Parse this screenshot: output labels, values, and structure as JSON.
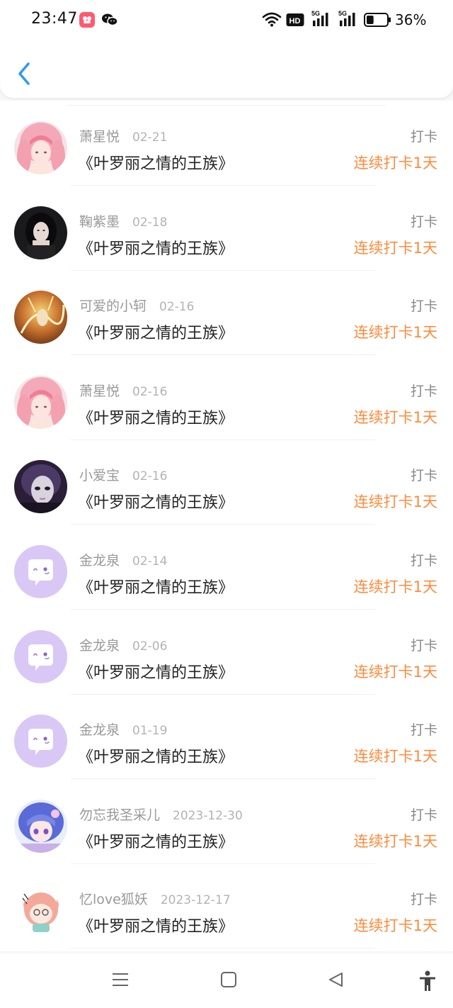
{
  "status_bar": {
    "time": "23:47",
    "battery_percent_text": "36%",
    "battery_level": 0.36,
    "network_badges": [
      "HD",
      "5G",
      "5G"
    ],
    "icons": [
      "app-notification-icon",
      "wechat-icon",
      "wifi-icon",
      "hd-icon",
      "signal-5g-icon",
      "signal-5g-icon",
      "battery-icon"
    ]
  },
  "header": {
    "back_icon": "chevron-left-icon",
    "accent_color": "#2b9bf4"
  },
  "colors": {
    "username": "#999999",
    "date": "#b3b3b3",
    "title": "#222222",
    "checkin": "#888888",
    "streak": "#ff8a3d"
  },
  "records": [
    {
      "username": "萧星悦",
      "date": "02-21",
      "book_title": "《叶罗丽之情的王族》",
      "checkin_label": "打卡",
      "streak_label": "连续打卡1天",
      "avatar": "anime-pink-hair-avatar"
    },
    {
      "username": "鞠紫墨",
      "date": "02-18",
      "book_title": "《叶罗丽之情的王族》",
      "checkin_label": "打卡",
      "streak_label": "连续打卡1天",
      "avatar": "dark-hair-girl-avatar"
    },
    {
      "username": "可爱的小轲",
      "date": "02-16",
      "book_title": "《叶罗丽之情的王族》",
      "checkin_label": "打卡",
      "streak_label": "连续打卡1天",
      "avatar": "golden-art-avatar"
    },
    {
      "username": "萧星悦",
      "date": "02-16",
      "book_title": "《叶罗丽之情的王族》",
      "checkin_label": "打卡",
      "streak_label": "连续打卡1天",
      "avatar": "anime-pink-hair-avatar"
    },
    {
      "username": "小爱宝",
      "date": "02-16",
      "book_title": "《叶罗丽之情的王族》",
      "checkin_label": "打卡",
      "streak_label": "连续打卡1天",
      "avatar": "doll-face-avatar"
    },
    {
      "username": "金龙泉",
      "date": "02-14",
      "book_title": "《叶罗丽之情的王族》",
      "checkin_label": "打卡",
      "streak_label": "连续打卡1天",
      "avatar": "default-chat-bubble-avatar"
    },
    {
      "username": "金龙泉",
      "date": "02-06",
      "book_title": "《叶罗丽之情的王族》",
      "checkin_label": "打卡",
      "streak_label": "连续打卡1天",
      "avatar": "default-chat-bubble-avatar"
    },
    {
      "username": "金龙泉",
      "date": "01-19",
      "book_title": "《叶罗丽之情的王族》",
      "checkin_label": "打卡",
      "streak_label": "连续打卡1天",
      "avatar": "default-chat-bubble-avatar"
    },
    {
      "username": "勿忘我圣采儿",
      "date": "2023-12-30",
      "book_title": "《叶罗丽之情的王族》",
      "checkin_label": "打卡",
      "streak_label": "连续打卡1天",
      "avatar": "anime-purple-hair-avatar"
    },
    {
      "username": "忆love狐妖",
      "date": "2023-12-17",
      "book_title": "《叶罗丽之情的王族》",
      "checkin_label": "打卡",
      "streak_label": "连续打卡1天",
      "avatar": "chibi-pink-hair-avatar"
    }
  ],
  "nav_bar": {
    "icons": [
      "menu-icon",
      "home-square-icon",
      "back-triangle-icon",
      "accessibility-icon"
    ]
  }
}
